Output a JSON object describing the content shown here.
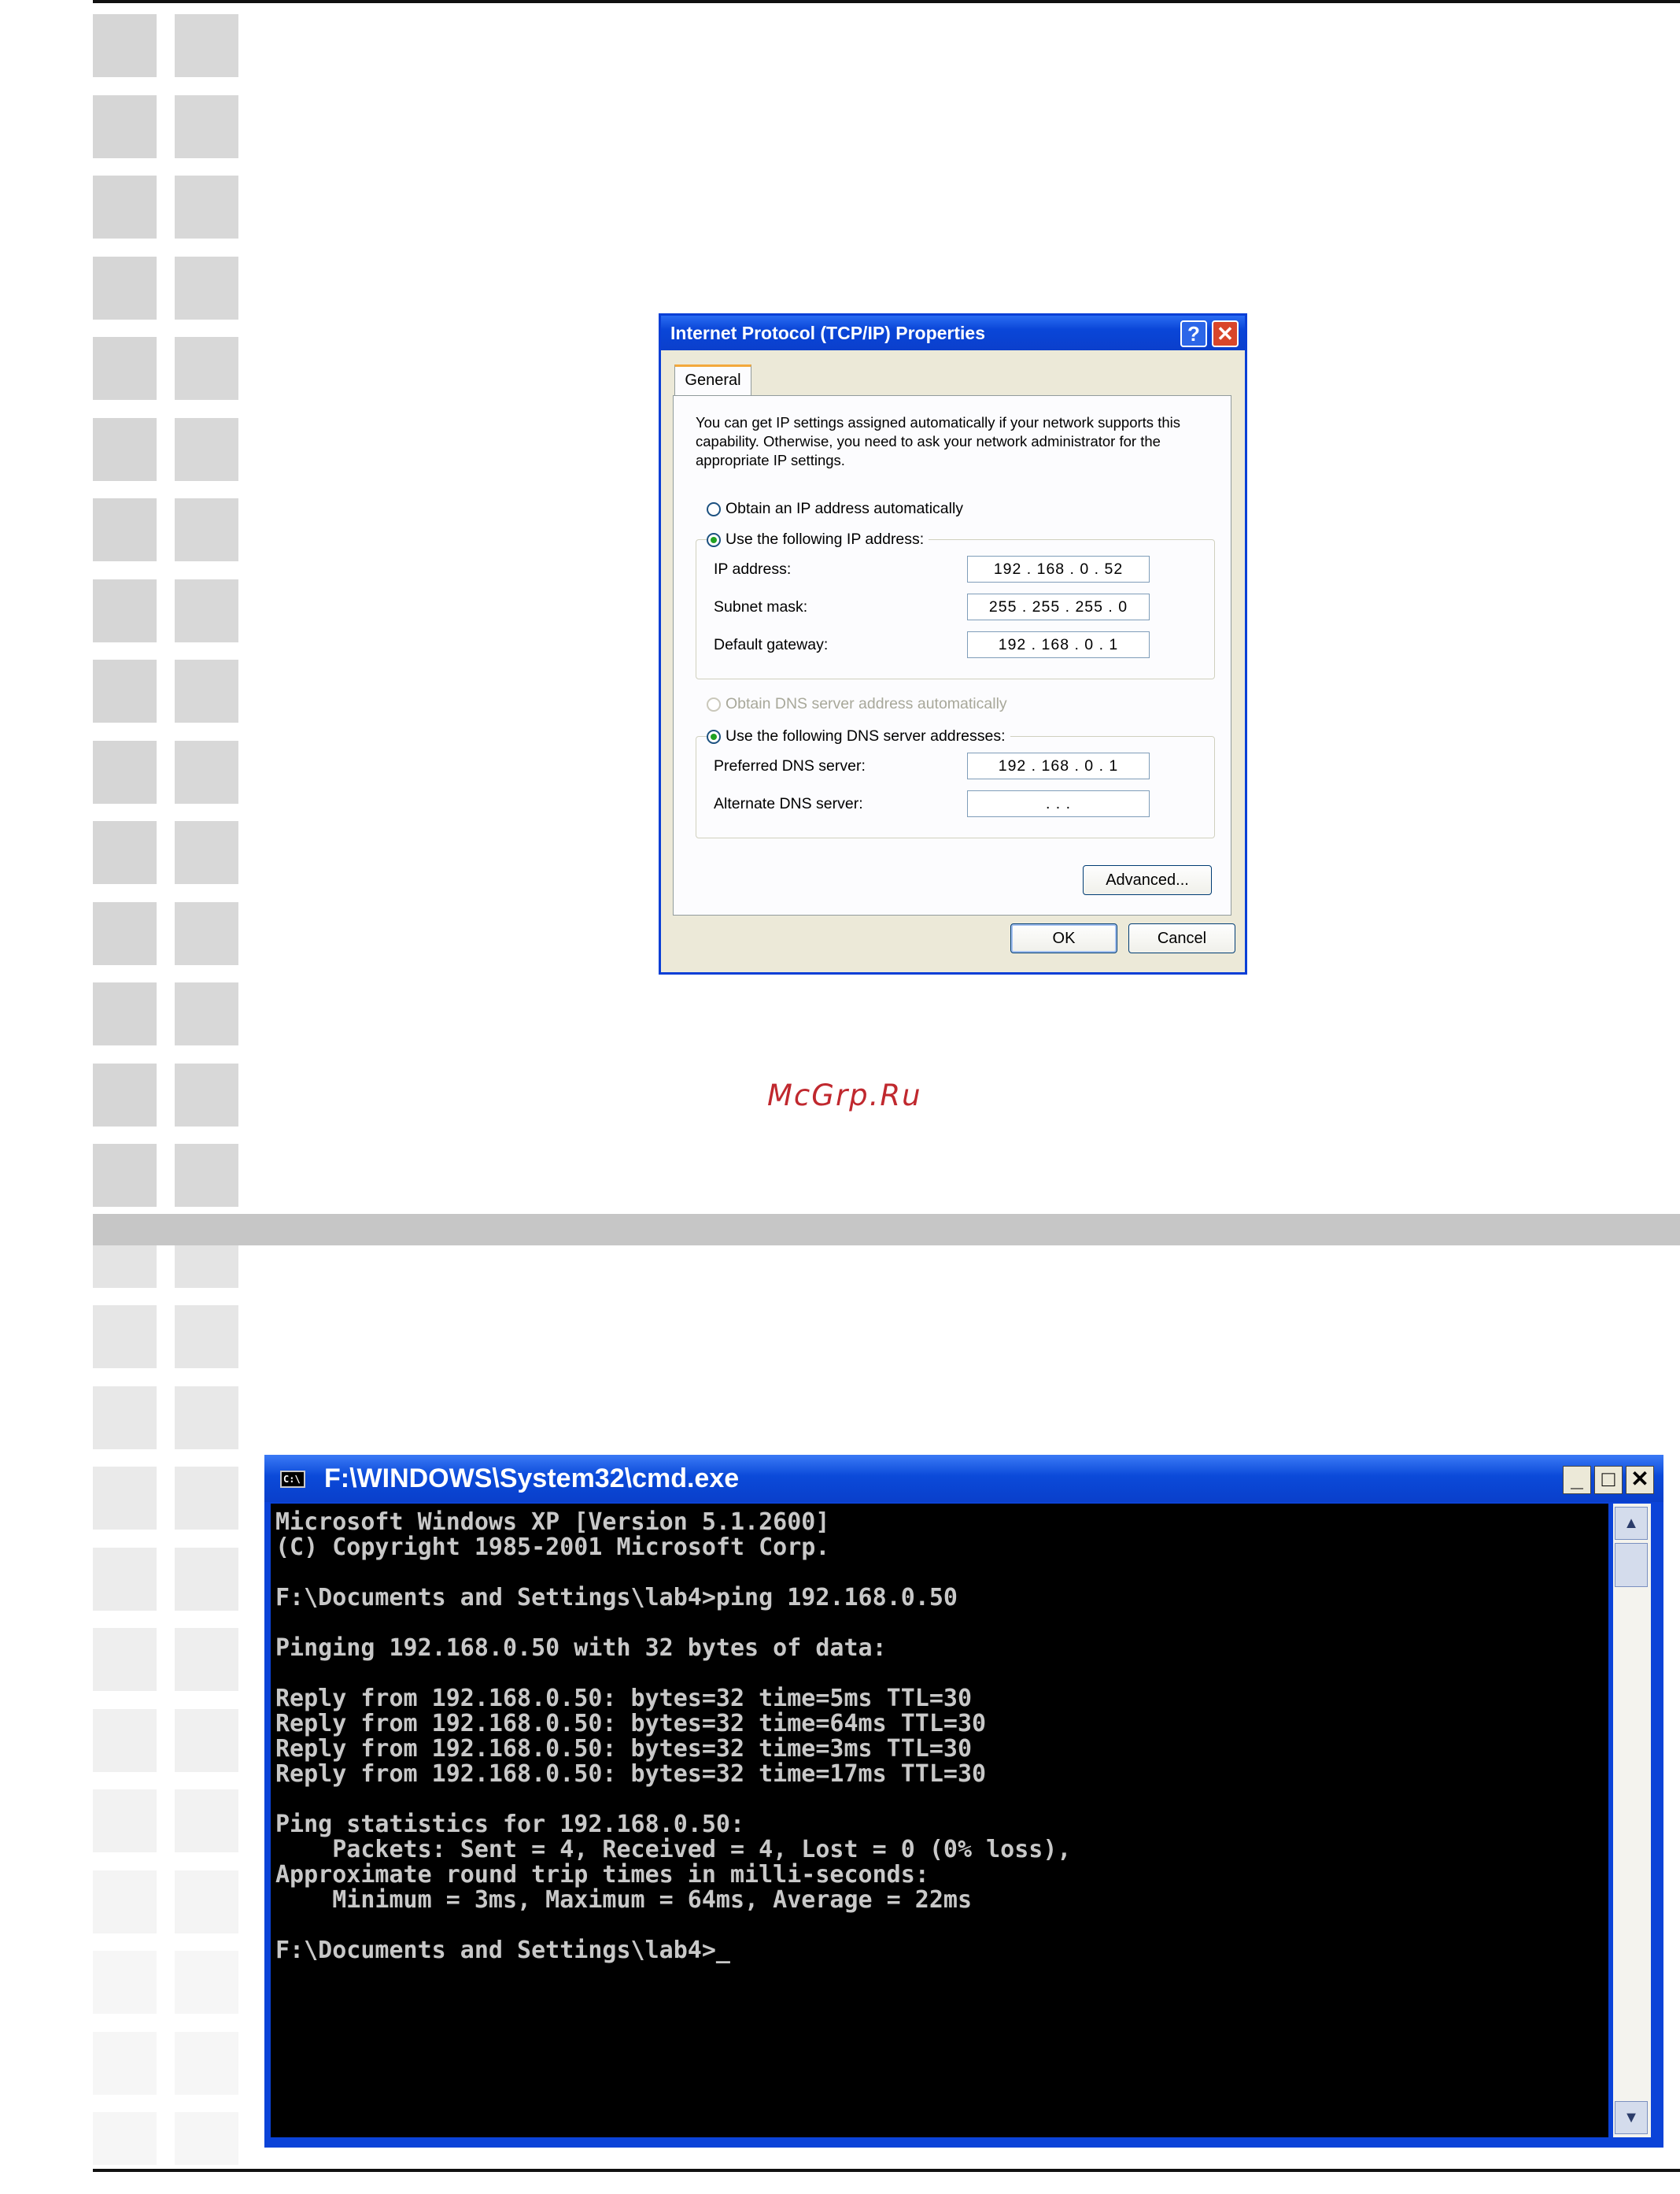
{
  "page": {
    "watermark": "McGrp.Ru"
  },
  "tcpip_dialog": {
    "title": "Internet Protocol (TCP/IP) Properties",
    "help_label": "?",
    "close_label": "✕",
    "tab_general": "General",
    "description": "You can get IP settings assigned automatically if your network supports this capability. Otherwise, you need to ask your network administrator for the appropriate IP settings.",
    "radio_ip_auto": "Obtain an IP address automatically",
    "radio_ip_manual": "Use the following IP address:",
    "ip_address_label": "IP address:",
    "ip_address_value": "192 . 168 .  0  .  52",
    "subnet_label": "Subnet mask:",
    "subnet_value": "255 . 255 . 255 .  0",
    "gateway_label": "Default gateway:",
    "gateway_value": "192 . 168 .  0  .  1",
    "radio_dns_auto": "Obtain DNS server address automatically",
    "radio_dns_manual": "Use the following DNS server addresses:",
    "preferred_dns_label": "Preferred DNS server:",
    "preferred_dns_value": "192 . 168 .  0  .  1",
    "alternate_dns_label": "Alternate DNS server:",
    "alternate_dns_value": ".       .       .",
    "advanced_label": "Advanced...",
    "ok_label": "OK",
    "cancel_label": "Cancel"
  },
  "cmd_window": {
    "icon_text": "C:\\",
    "title": "F:\\WINDOWS\\System32\\cmd.exe",
    "minimize_label": "_",
    "maximize_label": "□",
    "close_label": "✕",
    "lines": [
      "Microsoft Windows XP [Version 5.1.2600]",
      "(C) Copyright 1985-2001 Microsoft Corp.",
      "",
      "F:\\Documents and Settings\\lab4>ping 192.168.0.50",
      "",
      "Pinging 192.168.0.50 with 32 bytes of data:",
      "",
      "Reply from 192.168.0.50: bytes=32 time=5ms TTL=30",
      "Reply from 192.168.0.50: bytes=32 time=64ms TTL=30",
      "Reply from 192.168.0.50: bytes=32 time=3ms TTL=30",
      "Reply from 192.168.0.50: bytes=32 time=17ms TTL=30",
      "",
      "Ping statistics for 192.168.0.50:",
      "    Packets: Sent = 4, Received = 4, Lost = 0 (0% loss),",
      "Approximate round trip times in milli-seconds:",
      "    Minimum = 3ms, Maximum = 64ms, Average = 22ms",
      "",
      "F:\\Documents and Settings\\lab4>_"
    ],
    "scroll_up_icon": "scroll-up-arrow",
    "scroll_down_icon": "scroll-down-arrow"
  }
}
